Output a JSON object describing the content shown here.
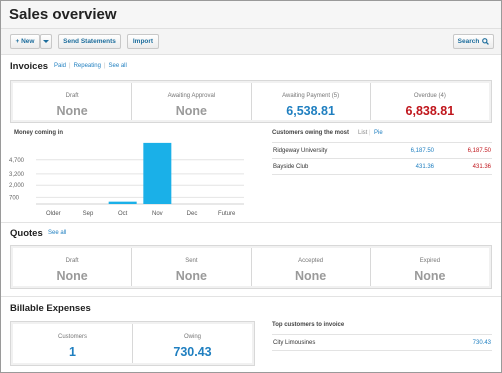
{
  "header": {
    "title": "Sales overview"
  },
  "toolbar": {
    "new_label": "+ New",
    "send_statements_label": "Send Statements",
    "import_label": "Import",
    "search_label": "Search"
  },
  "invoices": {
    "title": "Invoices",
    "links": [
      "Paid",
      "Repeating",
      "See all"
    ],
    "cards": [
      {
        "label": "Draft",
        "value": "None"
      },
      {
        "label": "Awaiting Approval",
        "value": "None"
      },
      {
        "label": "Awaiting Payment (5)",
        "value": "6,538.81"
      },
      {
        "label": "Overdue (4)",
        "value": "6,838.81"
      }
    ]
  },
  "money_coming_in": {
    "title": "Money coming in"
  },
  "chart_data": {
    "type": "bar",
    "categories": [
      "Older",
      "Sep",
      "Oct",
      "Nov",
      "Dec",
      "Future"
    ],
    "values": [
      0,
      0,
      250,
      6500,
      0,
      0
    ],
    "y_ticks": [
      "4,700",
      "3,200",
      "2,000",
      "700"
    ],
    "ylim": [
      0,
      6700
    ],
    "grid": true,
    "color": "#1ab0e8"
  },
  "customers_owing": {
    "title": "Customers owing the most",
    "view_list": "List",
    "view_pie": "Pie",
    "rows": [
      {
        "name": "Ridgeway University",
        "owing": "6,187.50",
        "overdue": "6,187.50"
      },
      {
        "name": "Bayside Club",
        "owing": "431.36",
        "overdue": "431.36"
      }
    ]
  },
  "quotes": {
    "title": "Quotes",
    "link": "See all",
    "cards": [
      {
        "label": "Draft",
        "value": "None"
      },
      {
        "label": "Sent",
        "value": "None"
      },
      {
        "label": "Accepted",
        "value": "None"
      },
      {
        "label": "Expired",
        "value": "None"
      }
    ]
  },
  "billable": {
    "title": "Billable Expenses",
    "cards": [
      {
        "label": "Customers",
        "value": "1"
      },
      {
        "label": "Owing",
        "value": "730.43"
      }
    ]
  },
  "top_customers": {
    "title": "Top customers to invoice",
    "rows": [
      {
        "name": "City Limousines",
        "amount": "730.43"
      }
    ]
  },
  "colors": {
    "link": "#1f7fc0",
    "overdue": "#c0161c",
    "bar": "#1ab0e8"
  }
}
